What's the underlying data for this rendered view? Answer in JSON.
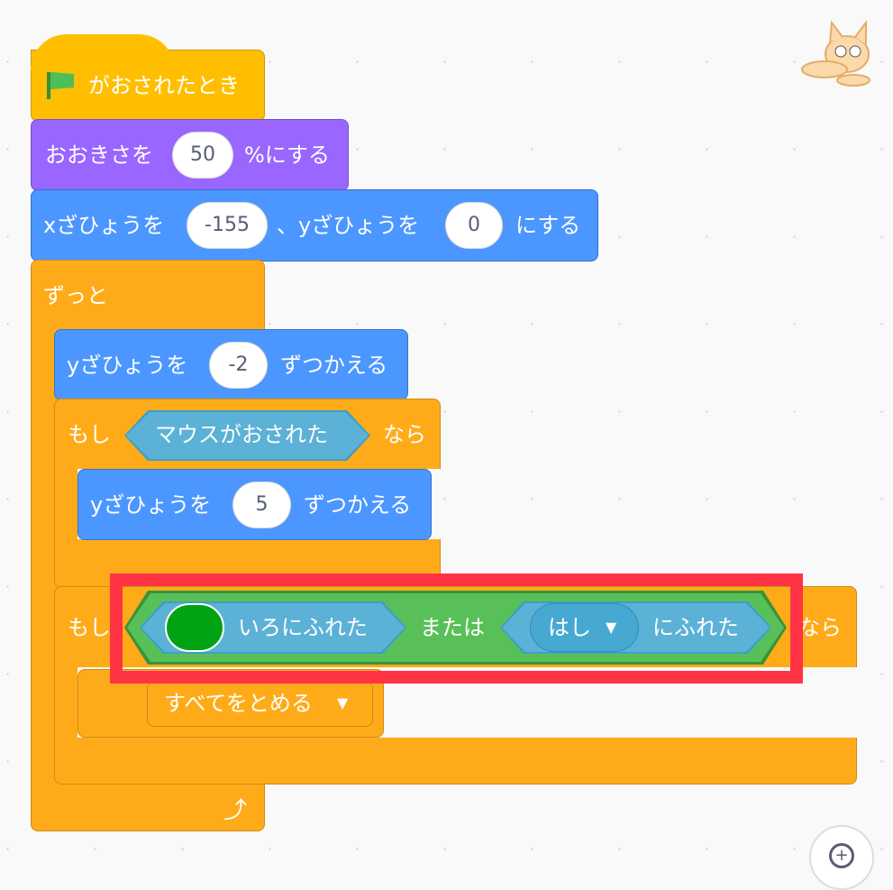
{
  "blocks": {
    "hat": {
      "label": "がおされたとき",
      "icon": "green-flag-icon"
    },
    "size": {
      "label_before": "おおきさを",
      "value": "50",
      "label_after": "%にする"
    },
    "goto": {
      "x_label": "xざひょうを",
      "x_value": "-155",
      "y_label": "、yざひょうを",
      "y_value": "0",
      "label_after": "にする"
    },
    "forever": {
      "label": "ずっと",
      "icon": "loop-arrow-icon"
    },
    "change_y1": {
      "label_before": "yざひょうを",
      "value": "-2",
      "label_after": "ずつかえる"
    },
    "if1": {
      "if_label": "もし",
      "condition": "マウスがおされた",
      "then_label": "なら"
    },
    "change_y2": {
      "label_before": "yざひょうを",
      "value": "5",
      "label_after": "ずつかえる"
    },
    "if2": {
      "if_label": "もし",
      "color_touch_label": "いろにふれた",
      "color": "#00a313",
      "or_label": "または",
      "touch_option": "はし",
      "touch_label": "にふれた",
      "then_label": "なら"
    },
    "stop": {
      "label": "すべてをとめる",
      "icon": "dropdown-arrow-icon"
    }
  },
  "colors": {
    "highlight": "#ff3344",
    "events": "#ffbf00",
    "looks": "#9966ff",
    "motion": "#4c97ff",
    "control": "#ffab19",
    "operators": "#59c059",
    "sensing": "#5cb1d6"
  },
  "sprite_icon": "scratch-cat-icon",
  "zoom_icon": "zoom-in-icon"
}
